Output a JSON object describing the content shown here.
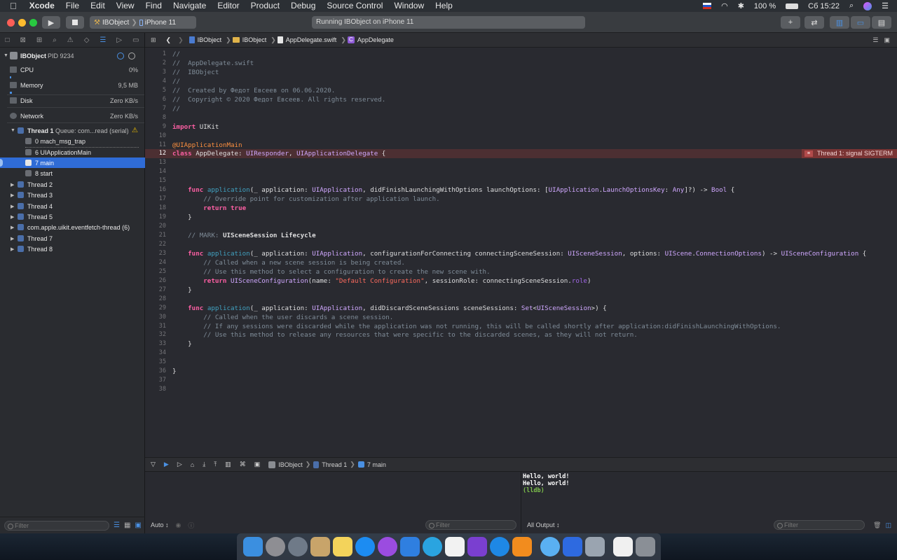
{
  "menubar": {
    "app": "Xcode",
    "items": [
      "File",
      "Edit",
      "View",
      "Find",
      "Navigate",
      "Editor",
      "Product",
      "Debug",
      "Source Control",
      "Window",
      "Help"
    ],
    "battery": "100 %",
    "clock": "Сб 15:22"
  },
  "toolbar": {
    "scheme": "IBObject",
    "device": "iPhone 11",
    "status": "Running IBObject on iPhone 11"
  },
  "debug_navigator": {
    "process": "IBObject",
    "pid": "PID 9234",
    "gauges": [
      {
        "label": "CPU",
        "value": "0%"
      },
      {
        "label": "Memory",
        "value": "9,5 MB"
      },
      {
        "label": "Disk",
        "value": "Zero KB/s"
      },
      {
        "label": "Network",
        "value": "Zero KB/s"
      }
    ],
    "thread1": "Thread 1",
    "thread1_queue": "Queue: com...read (serial)",
    "frames": [
      "0 mach_msg_trap",
      "6 UIApplicationMain",
      "7 main",
      "8 start"
    ],
    "threads": [
      "Thread 2",
      "Thread 3",
      "Thread 4",
      "Thread 5",
      "com.apple.uikit.eventfetch-thread (6)",
      "Thread 7",
      "Thread 8"
    ],
    "filter_placeholder": "Filter"
  },
  "jumpbar": {
    "project": "IBObject",
    "group": "IBObject",
    "file": "AppDelegate.swift",
    "symbol": "AppDelegate",
    "symbol_badge": "C"
  },
  "editor": {
    "error_line": 12,
    "error_badge": "Thread 1: signal SIGTERM",
    "lines": [
      "//",
      "//  AppDelegate.swift",
      "//  IBObject",
      "//",
      "//  Created by Федот Евсеев on 06.06.2020.",
      "//  Copyright © 2020 Федот Евсеев. All rights reserved.",
      "//",
      "",
      "import UIKit",
      "",
      "@UIApplicationMain",
      "class AppDelegate: UIResponder, UIApplicationDelegate {",
      "",
      "",
      "",
      "    func application(_ application: UIApplication, didFinishLaunchingWithOptions launchOptions: [UIApplication.LaunchOptionsKey: Any]?) -> Bool {",
      "        // Override point for customization after application launch.",
      "        return true",
      "    }",
      "",
      "    // MARK: UISceneSession Lifecycle",
      "",
      "    func application(_ application: UIApplication, configurationForConnecting connectingSceneSession: UISceneSession, options: UIScene.ConnectionOptions) -> UISceneConfiguration {",
      "        // Called when a new scene session is being created.",
      "        // Use this method to select a configuration to create the new scene with.",
      "        return UISceneConfiguration(name: \"Default Configuration\", sessionRole: connectingSceneSession.role)",
      "    }",
      "",
      "    func application(_ application: UIApplication, didDiscardSceneSessions sceneSessions: Set<UISceneSession>) {",
      "        // Called when the user discards a scene session.",
      "        // If any sessions were discarded while the application was not running, this will be called shortly after application:didFinishLaunchingWithOptions.",
      "        // Use this method to release any resources that were specific to the discarded scenes, as they will not return.",
      "    }",
      "",
      "",
      "}",
      "",
      ""
    ]
  },
  "debugbar": {
    "process": "IBObject",
    "thread": "Thread 1",
    "frame": "7 main"
  },
  "variables": {
    "scope": "Auto",
    "filter_placeholder": "Filter"
  },
  "console": {
    "lines": [
      "Hello, world!",
      "Hello, world!"
    ],
    "prompt": "(lldb)",
    "output_mode": "All Output",
    "filter_placeholder": "Filter"
  },
  "dock": {
    "icons": [
      "finder-icon",
      "system-preferences-icon",
      "launchpad-icon",
      "contacts-icon",
      "notes-icon",
      "app-store-icon",
      "podcasts-icon",
      "xcode-icon",
      "telegram-icon",
      "music-icon",
      "final-cut-icon",
      "safari-icon",
      "vlc-icon",
      "messages-icon",
      "simulator-icon",
      "instruments-icon",
      "documents-icon",
      "trash-icon"
    ],
    "colors": [
      "#3b8fe0",
      "#8e8e93",
      "#6f7a88",
      "#c8a46a",
      "#f3d35b",
      "#1c8cf2",
      "#9b4ce0",
      "#2f7fe0",
      "#2aa4e0",
      "#f2f2f2",
      "#7a3fd0",
      "#1e88e5",
      "#f28c1e",
      "#5ab0f2",
      "#2e6ae0",
      "#9aa4b0",
      "#f0f0f0",
      "#8a8f96"
    ]
  }
}
